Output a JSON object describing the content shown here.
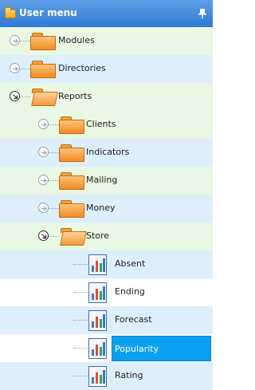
{
  "header": {
    "title": "User menu",
    "pin_icon": "pin-icon"
  },
  "tree": {
    "modules": "Modules",
    "directories": "Directories",
    "reports": "Reports",
    "clients": "Clients",
    "indicators": "Indicators",
    "mailing": "Mailing",
    "money": "Money",
    "store": "Store",
    "absent": "Absent",
    "ending": "Ending",
    "forecast": "Forecast",
    "popularity": "Popularity",
    "rating": "Rating"
  },
  "selected_item": "Popularity",
  "colors": {
    "header": "#3b84da",
    "row_green": "#e9f7e3",
    "row_blue": "#ddeefc",
    "selection": "#0aa0f0",
    "folder": "#f39a3a"
  }
}
